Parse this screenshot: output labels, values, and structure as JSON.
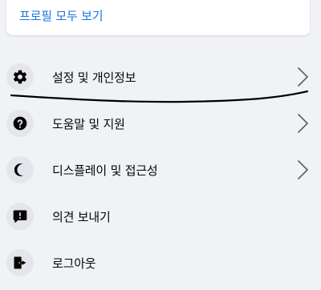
{
  "profile": {
    "see_all_label": "프로필 모두 보기"
  },
  "menu": {
    "items": [
      {
        "label": "설정 및 개인정보",
        "icon": "gear-icon",
        "has_chevron": true
      },
      {
        "label": "도움말 및 지원",
        "icon": "question-icon",
        "has_chevron": true
      },
      {
        "label": "디스플레이 및 접근성",
        "icon": "moon-icon",
        "has_chevron": true
      },
      {
        "label": "의견 보내기",
        "icon": "feedback-icon",
        "has_chevron": false
      },
      {
        "label": "로그아웃",
        "icon": "logout-icon",
        "has_chevron": false
      }
    ]
  },
  "colors": {
    "background": "#f0f2f5",
    "card": "#ffffff",
    "link": "#1b74e4",
    "icon_bg": "#e4e6eb",
    "icon": "#050505",
    "chevron": "#606770",
    "ink": "#000000"
  }
}
